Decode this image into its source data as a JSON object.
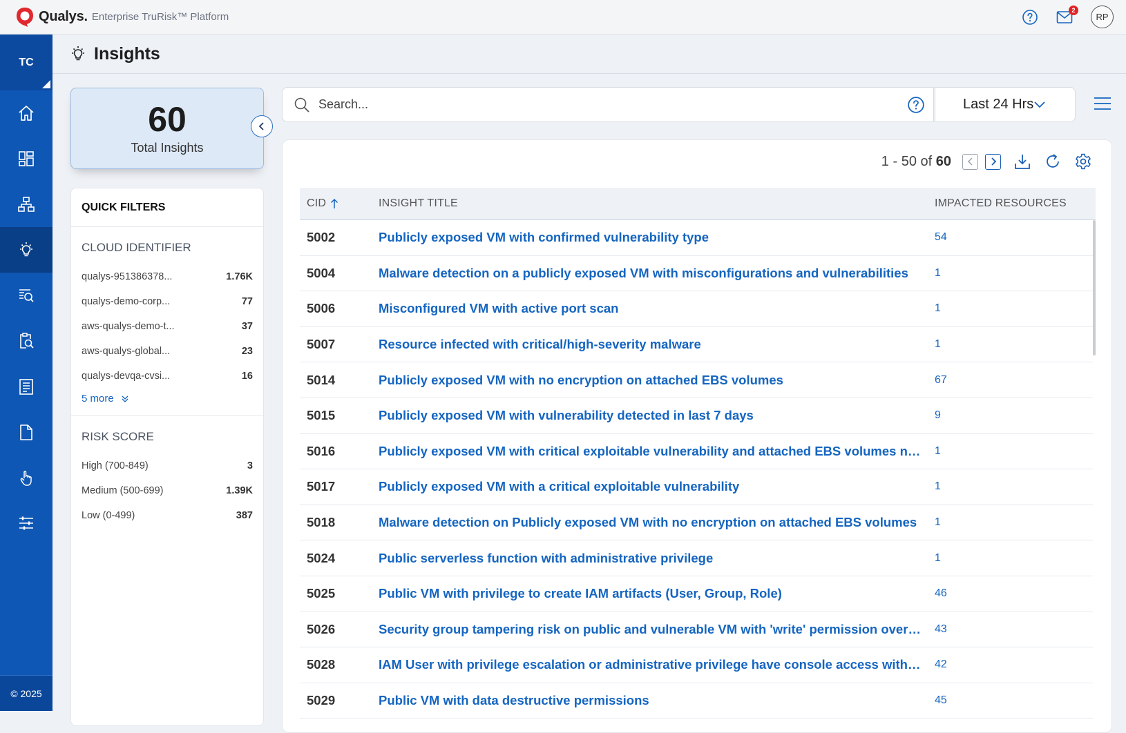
{
  "topbar": {
    "brand_name": "Qualys.",
    "brand_sub": "Enterprise TruRisk™ Platform",
    "mail_count": "2",
    "user_initials": "RP",
    "icons": [
      "qualys-logo-icon",
      "help-icon",
      "mail-icon"
    ]
  },
  "sidenav": {
    "tenant": "TC",
    "items": [
      {
        "name": "home",
        "icon": "home-icon"
      },
      {
        "name": "dashboard",
        "icon": "dashboard-icon"
      },
      {
        "name": "inventory",
        "icon": "hierarchy-icon"
      },
      {
        "name": "insights",
        "icon": "lightbulb-icon",
        "active": true
      },
      {
        "name": "search",
        "icon": "search-doc-icon"
      },
      {
        "name": "investigate",
        "icon": "report-search-icon"
      },
      {
        "name": "reports",
        "icon": "list-doc-icon"
      },
      {
        "name": "documents",
        "icon": "file-icon"
      },
      {
        "name": "response",
        "icon": "touch-icon"
      },
      {
        "name": "settings",
        "icon": "sliders-icon"
      }
    ],
    "copyright": "© 2025"
  },
  "header": {
    "title": "Insights",
    "icon": "lightbulb-icon"
  },
  "summary": {
    "total": "60",
    "label": "Total Insights"
  },
  "filters": {
    "title": "QUICK FILTERS",
    "cloud": {
      "heading": "CLOUD IDENTIFIER",
      "items": [
        {
          "label": "qualys-951386378...",
          "count": "1.76K"
        },
        {
          "label": "qualys-demo-corp...",
          "count": "77"
        },
        {
          "label": "aws-qualys-demo-t...",
          "count": "37"
        },
        {
          "label": "aws-qualys-global...",
          "count": "23"
        },
        {
          "label": "qualys-devqa-cvsi...",
          "count": "16"
        }
      ],
      "more": "5 more"
    },
    "risk": {
      "heading": "RISK SCORE",
      "items": [
        {
          "label": "High (700-849)",
          "count": "3"
        },
        {
          "label": "Medium (500-699)",
          "count": "1.39K"
        },
        {
          "label": "Low (0-499)",
          "count": "387"
        }
      ]
    }
  },
  "search": {
    "placeholder": "Search...",
    "range": "Last 24 Hrs"
  },
  "pager": {
    "range": "1 - 50 of",
    "total": "60"
  },
  "table": {
    "columns": {
      "cid": "CID",
      "title": "INSIGHT TITLE",
      "resources": "IMPACTED RESOURCES"
    },
    "rows": [
      {
        "cid": "5002",
        "title": "Publicly exposed VM with confirmed vulnerability type",
        "resources": "54"
      },
      {
        "cid": "5004",
        "title": "Malware detection on a publicly exposed VM with misconfigurations and vulnerabilities",
        "resources": "1"
      },
      {
        "cid": "5006",
        "title": "Misconfigured VM with active port scan",
        "resources": "1"
      },
      {
        "cid": "5007",
        "title": "Resource infected with critical/high-severity malware",
        "resources": "1"
      },
      {
        "cid": "5014",
        "title": "Publicly exposed VM with no encryption on attached EBS volumes",
        "resources": "67"
      },
      {
        "cid": "5015",
        "title": "Publicly exposed VM with vulnerability detected in last 7 days",
        "resources": "9"
      },
      {
        "cid": "5016",
        "title": "Publicly exposed VM with critical exploitable vulnerability and attached EBS volumes not ...",
        "resources": "1"
      },
      {
        "cid": "5017",
        "title": "Publicly exposed VM with a critical exploitable vulnerability",
        "resources": "1"
      },
      {
        "cid": "5018",
        "title": "Malware detection on Publicly exposed VM with no encryption on attached EBS volumes",
        "resources": "1"
      },
      {
        "cid": "5024",
        "title": "Public serverless function with administrative privilege",
        "resources": "1"
      },
      {
        "cid": "5025",
        "title": "Public VM with privilege to create IAM artifacts (User, Group, Role)",
        "resources": "46"
      },
      {
        "cid": "5026",
        "title": "Security group tampering risk on public and vulnerable VM with 'write' permission over se...",
        "resources": "43"
      },
      {
        "cid": "5028",
        "title": "IAM User with privilege escalation or administrative privilege have console access with M...",
        "resources": "42"
      },
      {
        "cid": "5029",
        "title": "Public VM with data destructive permissions",
        "resources": "45"
      }
    ]
  }
}
